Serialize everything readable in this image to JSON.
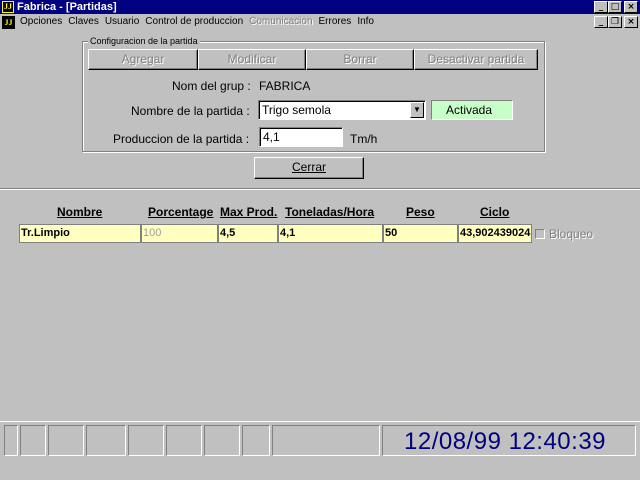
{
  "window": {
    "title": "Fabrica - [Partidas]"
  },
  "menu": {
    "items": [
      "Opciones",
      "Claves",
      "Usuario",
      "Control de produccion",
      "Comunicacion",
      "Errores",
      "Info"
    ]
  },
  "group": {
    "legend": "Configuracion de la partida",
    "buttons": {
      "agregar": "Agregar",
      "modificar": "Modificar",
      "borrar": "Borrar",
      "desactivar": "Desactivar partida"
    },
    "nom_grup_label": "Nom del grup :",
    "nom_grup_value": "FABRICA",
    "nombre_partida_label": "Nombre de la partida :",
    "nombre_partida_value": "Trigo semola",
    "status": "Activada",
    "produccion_label": "Produccion de la partida :",
    "produccion_value": "4,1",
    "produccion_unit": "Tm/h"
  },
  "cerrar_button": "Cerrar",
  "table": {
    "headers": [
      "Nombre",
      "Porcentage",
      "Max Prod.",
      "Toneladas/Hora",
      "Peso",
      "Ciclo"
    ],
    "row": [
      "Tr.Limpio",
      "100",
      "4,5",
      "4,1",
      "50",
      "43,902439024"
    ],
    "bloqueo_label": "Bloqueo"
  },
  "statusbar": {
    "datetime": "12/08/99 12:40:39"
  },
  "colors": {
    "title_bg": "#000080",
    "row_bg": "#ffffc0",
    "activada_bg": "#c8ffc8",
    "clock": "#000080"
  }
}
